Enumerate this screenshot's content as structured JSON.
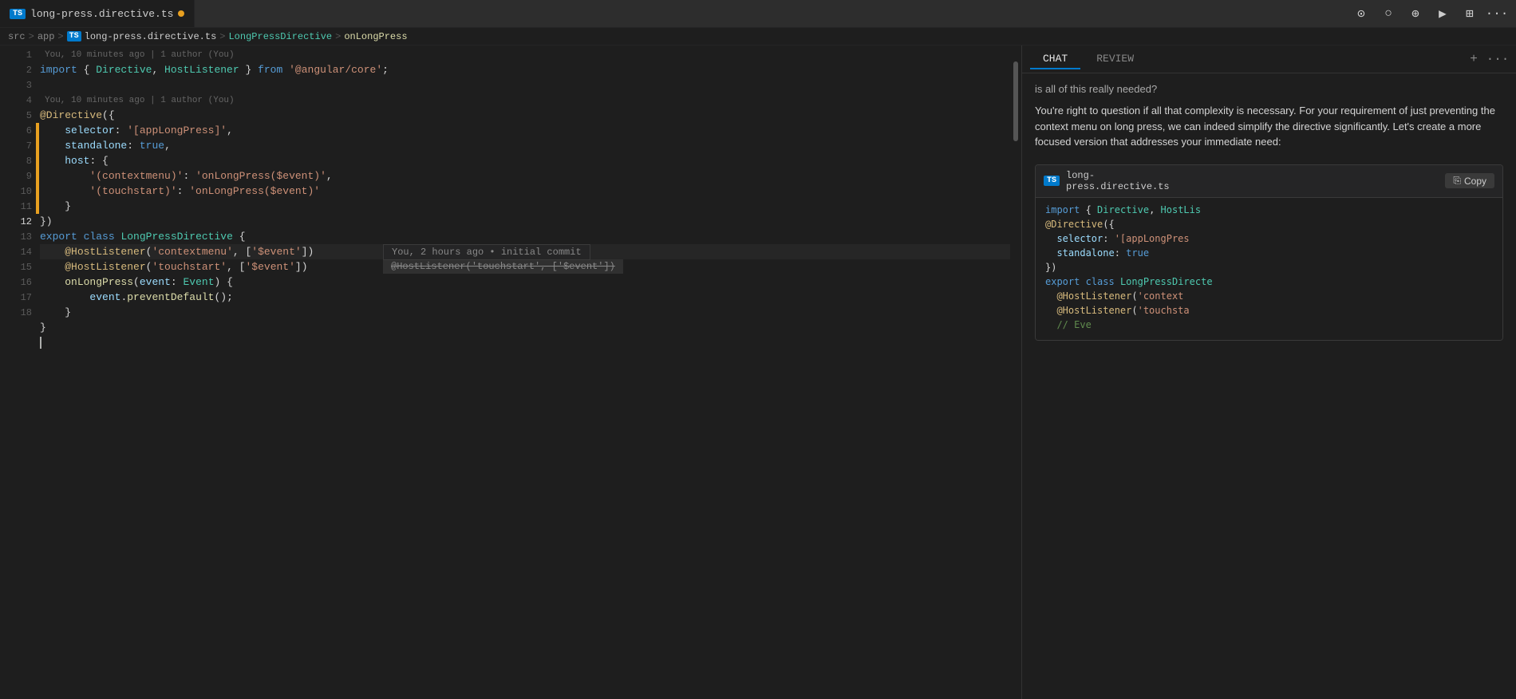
{
  "tab": {
    "label": "long-press.directive.ts",
    "badge": "TS",
    "modified": true
  },
  "breadcrumb": {
    "items": [
      "src",
      ">",
      "app",
      ">",
      "TS",
      "long-press.directive.ts",
      ">",
      "LongPressDirective",
      ">",
      "onLongPress"
    ]
  },
  "blame": {
    "line1": "You, 10 minutes ago | 1 author (You)",
    "line3": "You, 10 minutes ago | 1 author (You)"
  },
  "code": {
    "lines": [
      {
        "num": 1,
        "content": "import { Directive, HostListener } from '@angular/core';"
      },
      {
        "num": 2,
        "content": ""
      },
      {
        "num": 3,
        "content": "@Directive({"
      },
      {
        "num": 4,
        "content": "    selector: '[appLongPress]',"
      },
      {
        "num": 5,
        "content": "    standalone: true,"
      },
      {
        "num": 6,
        "content": "    host: {"
      },
      {
        "num": 7,
        "content": "        '(contextmenu)': 'onLongPress($event)',"
      },
      {
        "num": 8,
        "content": "        '(touchstart)': 'onLongPress($event)'"
      },
      {
        "num": 9,
        "content": "    }"
      },
      {
        "num": 10,
        "content": "})"
      },
      {
        "num": 11,
        "content": "export class LongPressDirective {"
      },
      {
        "num": 12,
        "content": "    @HostListener('contextmenu', ['$event'])"
      },
      {
        "num": 13,
        "content": "    @HostListener('touchstart', ['$event'])"
      },
      {
        "num": 14,
        "content": "    onLongPress(event: Event) {"
      },
      {
        "num": 15,
        "content": "        event.preventDefault();"
      },
      {
        "num": 16,
        "content": "    }"
      },
      {
        "num": 17,
        "content": "}"
      },
      {
        "num": 18,
        "content": ""
      }
    ]
  },
  "inline_tooltip": {
    "text": "You, 2 hours ago • initial commit"
  },
  "inline_strikethrough": {
    "text": "@HostListener('touchstart', ['$event'])"
  },
  "right_panel": {
    "tabs": [
      "CHAT",
      "REVIEW"
    ],
    "active_tab": "CHAT",
    "add_icon": "+",
    "more_icon": "···"
  },
  "chat": {
    "question": "is all of this really needed?",
    "answer": "You're right to question if all that complexity is necessary. For your requirement of just preventing the context menu on long press, we can indeed simplify the directive significantly. Let's create a more focused version that addresses your immediate need:",
    "code_ref": {
      "filename": "long-press.directive.ts",
      "badge": "TS",
      "copy_label": "Copy",
      "lines": [
        "import { Directive, HostLis",
        "@Directive({",
        "    selector: '[appLongPres",
        "    standalone: true",
        "})",
        "export class LongPressDirecte",
        "    @HostListener('context",
        "    @HostListener('touchsta",
        "    // Eve"
      ]
    }
  },
  "toolbar": {
    "icons": [
      "◎",
      "○",
      "◯",
      "▶",
      "⊞",
      "···"
    ]
  }
}
